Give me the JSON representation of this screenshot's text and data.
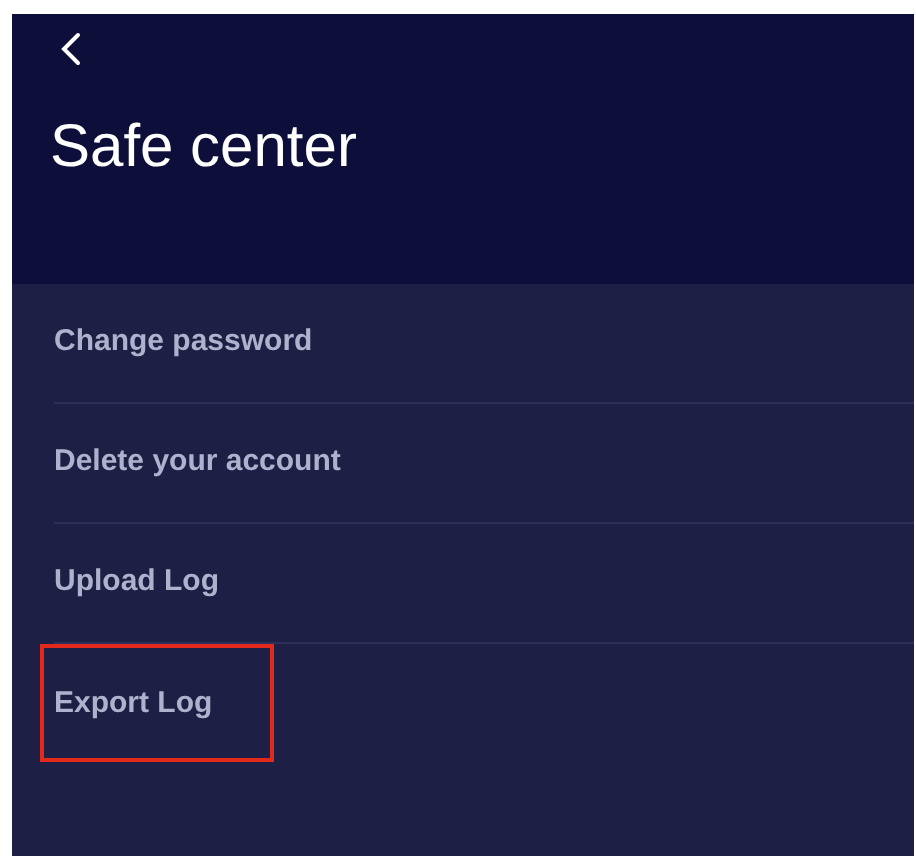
{
  "header": {
    "title": "Safe center"
  },
  "items": [
    {
      "label": "Change password",
      "highlighted": false
    },
    {
      "label": "Delete your account",
      "highlighted": false
    },
    {
      "label": "Upload Log",
      "highlighted": false
    },
    {
      "label": "Export Log",
      "highlighted": true
    }
  ]
}
